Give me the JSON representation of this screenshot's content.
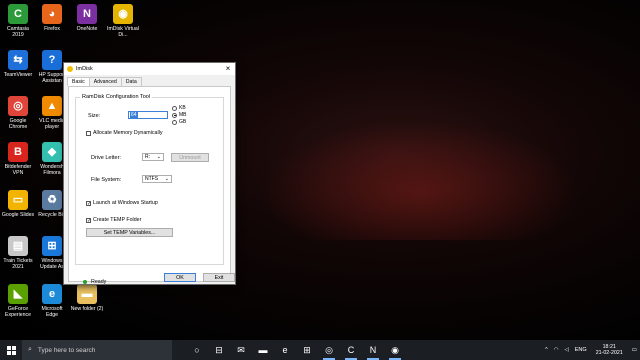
{
  "desktop": {
    "icons": [
      {
        "label": "Camtasia 2019",
        "icon": "camtasia-icon",
        "color": "#2d9a3a",
        "glyph": "C"
      },
      {
        "label": "Firefox",
        "icon": "firefox-icon",
        "color": "#e8661c",
        "glyph": "◕"
      },
      {
        "label": "OneNote",
        "icon": "onenote-icon",
        "color": "#7b2fa0",
        "glyph": "N"
      },
      {
        "label": "ImDisk Virtual Di...",
        "icon": "imdisk-icon",
        "color": "#e5b400",
        "glyph": "◉"
      },
      {
        "label": "TeamViewer",
        "icon": "teamviewer-icon",
        "color": "#1e6fd9",
        "glyph": "⇆"
      },
      {
        "label": "HP Support Assistan",
        "icon": "hp-support-icon",
        "color": "#1a6ed8",
        "glyph": "?"
      },
      {
        "label": "Google Chrome",
        "icon": "chrome-icon",
        "color": "#e0453a",
        "glyph": "◎"
      },
      {
        "label": "VLC media player",
        "icon": "vlc-icon",
        "color": "#f08a00",
        "glyph": "▲"
      },
      {
        "label": "Bitdefender VPN",
        "icon": "bitdefender-icon",
        "color": "#d8261f",
        "glyph": "B"
      },
      {
        "label": "Wondersh Filmora",
        "icon": "filmora-icon",
        "color": "#33c0b0",
        "glyph": "◆"
      },
      {
        "label": "Google Slides",
        "icon": "slides-icon",
        "color": "#f2b400",
        "glyph": "▭"
      },
      {
        "label": "Recycle Bin",
        "icon": "recycle-bin-icon",
        "color": "#5a7aa0",
        "glyph": "♻"
      },
      {
        "label": "Train Tickets 2021",
        "icon": "pdf-icon",
        "color": "#c8c8c8",
        "glyph": "▤"
      },
      {
        "label": "Windows Update As",
        "icon": "windows-update-icon",
        "color": "#1a78d8",
        "glyph": "⊞"
      },
      {
        "label": "GeForce Experience",
        "icon": "geforce-icon",
        "color": "#5aa000",
        "glyph": "◣"
      },
      {
        "label": "Microsoft Edge",
        "icon": "edge-icon",
        "color": "#1d8ad8",
        "glyph": "e"
      },
      {
        "label": "New folder (2)",
        "icon": "folder-icon",
        "color": "#e8c060",
        "glyph": "▬"
      }
    ]
  },
  "window": {
    "title": "ImDisk",
    "close_glyph": "×",
    "tabs": [
      "Basic",
      "Advanced",
      "Data"
    ],
    "group_title": "RamDisk Configuration Tool",
    "size_label": "Size:",
    "size_value": "64",
    "units": [
      {
        "label": "KB",
        "checked": false
      },
      {
        "label": "MB",
        "checked": true
      },
      {
        "label": "GB",
        "checked": false
      }
    ],
    "allocate_dynamic": {
      "label": "Allocate Memory Dynamically",
      "checked": false
    },
    "drive_letter_label": "Drive Letter:",
    "drive_letter_value": "R:",
    "unmount_label": "Unmount",
    "filesystem_label": "File System:",
    "filesystem_value": "NTFS",
    "launch_startup": {
      "label": "Launch at Windows Startup",
      "checked": true
    },
    "create_temp": {
      "label": "Create TEMP Folder",
      "checked": true
    },
    "set_temp_label": "Set TEMP Variables...",
    "status_text": "Ready",
    "ok_label": "OK",
    "exit_label": "Exit",
    "check_glyph": "✓",
    "combo_arrow": "⌄"
  },
  "taskbar": {
    "search_placeholder": "Type here to search",
    "search_glyph": "⌕",
    "apps": [
      {
        "icon": "task-view-icon",
        "glyph": "○"
      },
      {
        "icon": "timeline-icon",
        "glyph": "⊟"
      },
      {
        "icon": "mail-icon",
        "glyph": "✉"
      },
      {
        "icon": "file-explorer-icon",
        "glyph": "▬"
      },
      {
        "icon": "edge-icon",
        "glyph": "e"
      },
      {
        "icon": "store-icon",
        "glyph": "⊞"
      },
      {
        "icon": "chrome-icon",
        "glyph": "◎"
      },
      {
        "icon": "camtasia-icon",
        "glyph": "C"
      },
      {
        "icon": "onenote-icon",
        "glyph": "N"
      },
      {
        "icon": "imdisk-icon",
        "glyph": "◉"
      }
    ],
    "tray": {
      "chevron": "^",
      "language": "ENG",
      "time": "18:21",
      "date": "21-02-2021"
    }
  }
}
